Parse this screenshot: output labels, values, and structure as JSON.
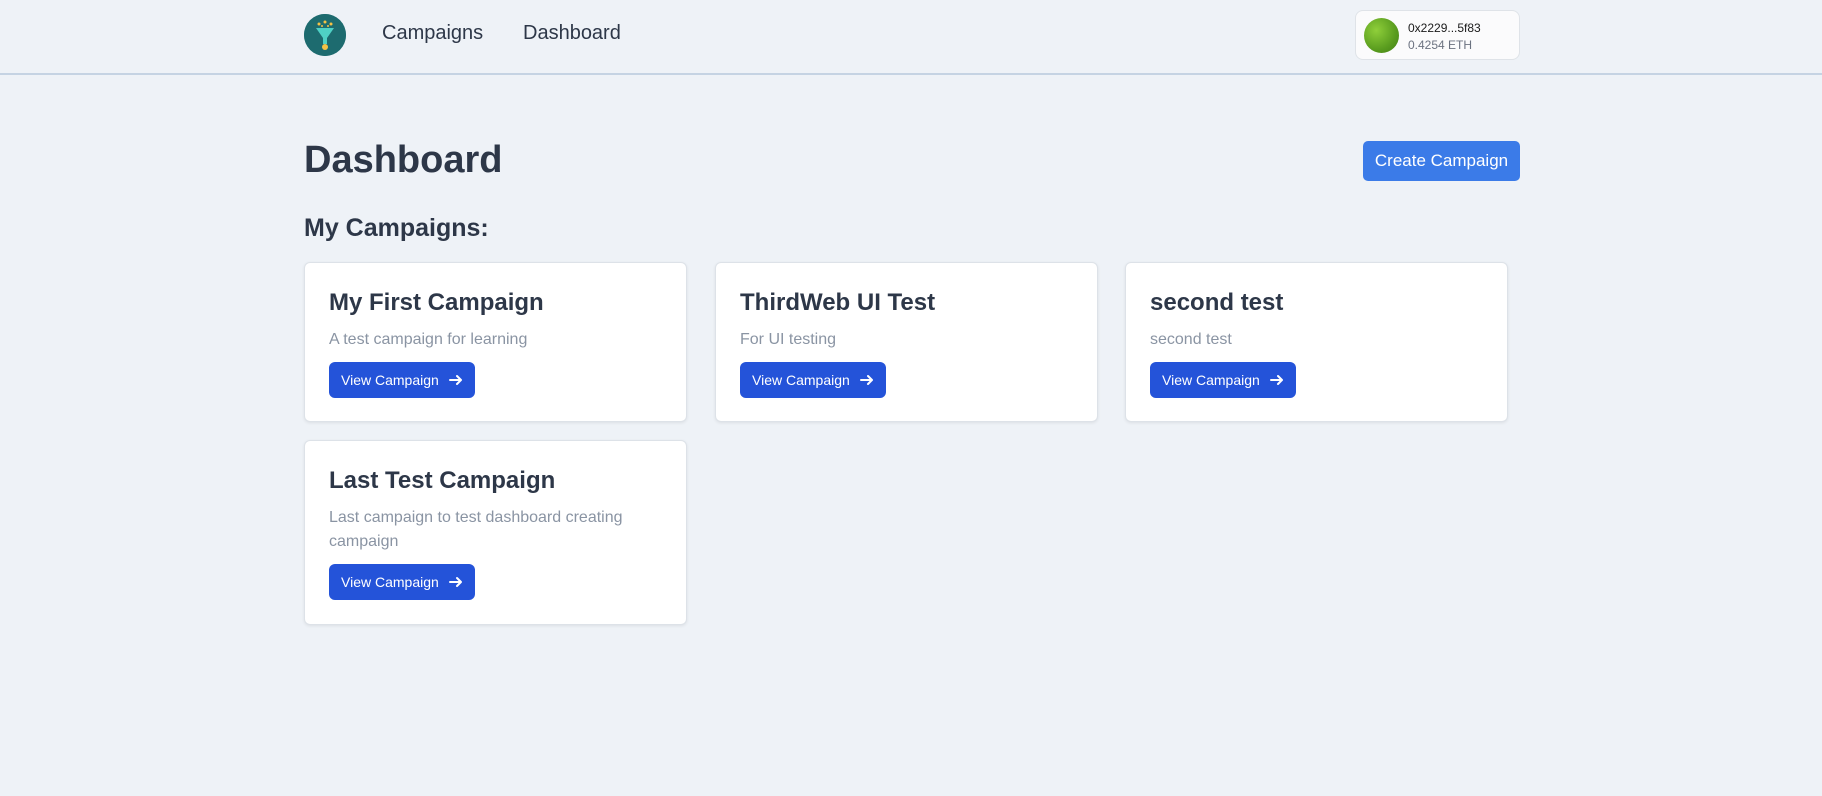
{
  "nav": {
    "campaigns_label": "Campaigns",
    "dashboard_label": "Dashboard"
  },
  "wallet": {
    "address": "0x2229...5f83",
    "balance": "0.4254 ETH"
  },
  "main": {
    "title": "Dashboard",
    "create_label": "Create Campaign",
    "section_title": "My Campaigns:"
  },
  "campaigns": [
    {
      "title": "My First Campaign",
      "description": "A test campaign for learning",
      "button_label": "View Campaign"
    },
    {
      "title": "ThirdWeb UI Test",
      "description": "For UI testing",
      "button_label": "View Campaign"
    },
    {
      "title": "second test",
      "description": "second test",
      "button_label": "View Campaign"
    },
    {
      "title": "Last Test Campaign",
      "description": "Last campaign to test dashboard creating campaign",
      "button_label": "View Campaign"
    }
  ],
  "colors": {
    "background": "#eef2f7",
    "primary_button": "#3b7be8",
    "card_button": "#2453d9",
    "logo": "#1d6b6f"
  },
  "icons": {
    "logo": "funnel-logo-icon",
    "wallet_avatar": "wallet-avatar-icon",
    "arrow": "arrow-right-icon"
  }
}
